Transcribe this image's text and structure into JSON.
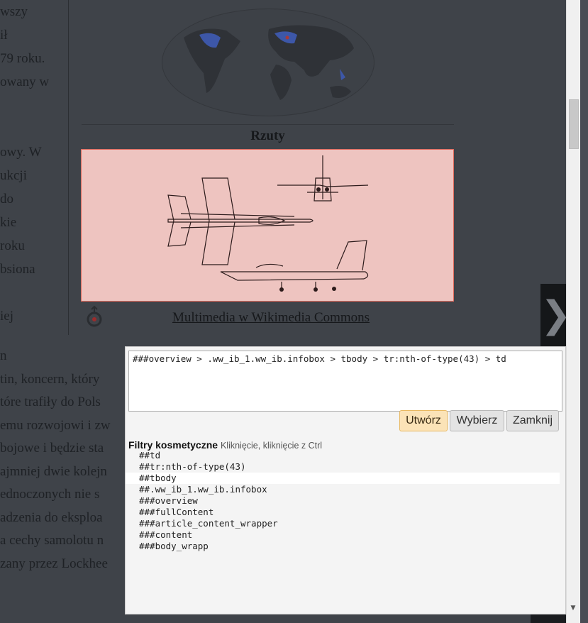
{
  "article": {
    "left_lines": [
      "wszy",
      "ił",
      "79 roku.",
      "owany w",
      "",
      "",
      "owy. W",
      "ukcji",
      "do",
      "kie",
      "roku",
      "bsiona",
      "",
      "iej"
    ],
    "below_lines": [
      "n",
      "tin, koncern, który",
      "tóre trafiły do Pols",
      "emu rozwojowi i zw",
      "bojowe i będzie sta",
      "ajmniej dwie kolejn",
      "ednoczonych nie s",
      "adzenia do eksploa",
      "a cechy samolotu n",
      "zany przez Lockhee"
    ]
  },
  "infobox": {
    "caption": "Rzuty",
    "commons_link": "Multimedia w Wikimedia Commons"
  },
  "panel": {
    "selector_value": "###overview > .ww_ib_1.ww_ib.infobox > tbody > tr:nth-of-type(43) > td",
    "create_label": "Utwórz",
    "pick_label": "Wybierz",
    "close_label": "Zamknij",
    "filters_title": "Filtry kosmetyczne",
    "filters_hint": "Kliknięcie, kliknięcie z Ctrl",
    "filters": [
      "##td",
      "##tr:nth-of-type(43)",
      "##tbody",
      "##.ww_ib_1.ww_ib.infobox",
      "###overview",
      "###fullContent",
      "###article_content_wrapper",
      "###content",
      "###body_wrapp"
    ],
    "highlighted_index": 2
  },
  "colors": {
    "accent_button": "#fbe3b7",
    "projection_bg": "#eec4c0",
    "projection_border": "#e06a5c"
  },
  "icons": {
    "next": "chevron-right-icon",
    "commons": "wikimedia-commons-icon",
    "scroll_down": "scroll-down-arrow-icon"
  }
}
